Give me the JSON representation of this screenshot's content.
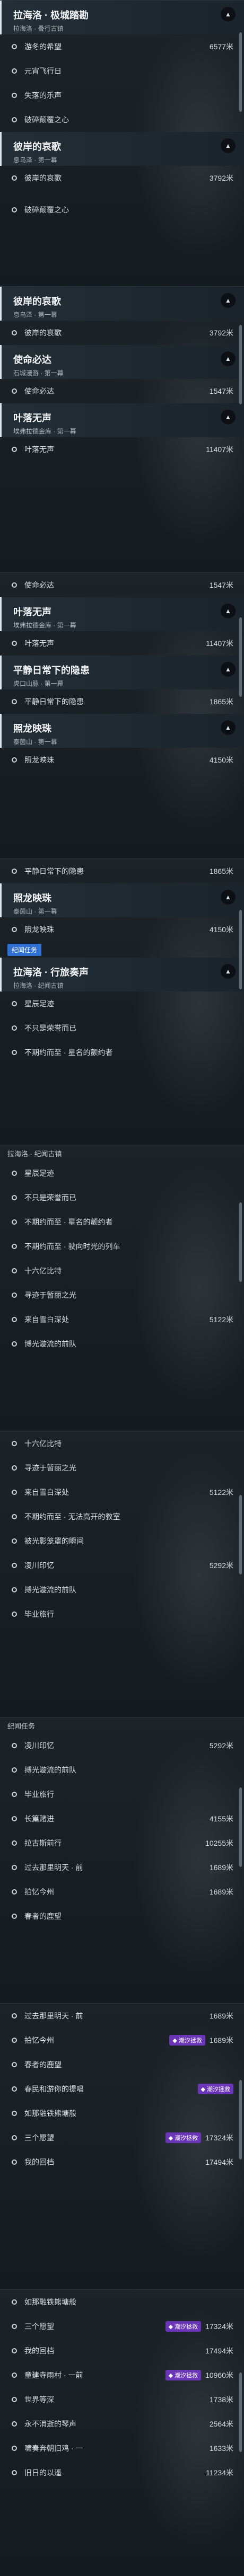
{
  "panels": [
    {
      "items": [
        {
          "type": "header",
          "title": "拉海洛 · 极城踏勘",
          "sub": "拉海洛 · 叠行古镇",
          "chevron": true
        },
        {
          "type": "item",
          "label": "游冬的希望",
          "dist": "6577米"
        },
        {
          "type": "item",
          "label": "元宵飞行日"
        },
        {
          "type": "item",
          "label": "失落的乐声"
        },
        {
          "type": "item",
          "label": "破碎颠覆之心"
        },
        {
          "type": "header",
          "title": "彼岸的哀歌",
          "sub": "息乌泽 · 第一幕",
          "chevron": true
        },
        {
          "type": "item",
          "label": "彼岸的哀歌",
          "dist": "3792米"
        },
        {
          "type": "spacer"
        },
        {
          "type": "item",
          "label": "破碎颠覆之心"
        }
      ]
    },
    {
      "items": [
        {
          "type": "header",
          "title": "彼岸的哀歌",
          "sub": "息乌泽 · 第一幕",
          "chevron": true
        },
        {
          "type": "item",
          "label": "彼岸的哀歌",
          "dist": "3792米"
        },
        {
          "type": "header",
          "title": "使命必达",
          "sub": "石城漫游 · 第一幕",
          "chevron": true
        },
        {
          "type": "item",
          "label": "使命必达",
          "dist": "1547米"
        },
        {
          "type": "header",
          "title": "叶落无声",
          "sub": "埃弗拉德金库 · 第一幕",
          "chevron": true
        },
        {
          "type": "item",
          "label": "叶落无声",
          "dist": "11407米"
        }
      ]
    },
    {
      "items": [
        {
          "type": "item",
          "label": "使命必达",
          "dist": "1547米"
        },
        {
          "type": "header",
          "title": "叶落无声",
          "sub": "埃弗拉德金库 · 第一幕",
          "chevron": true
        },
        {
          "type": "item",
          "label": "叶落无声",
          "dist": "11407米"
        },
        {
          "type": "header",
          "title": "平静日常下的隐患",
          "sub": "虎口山脉 · 第一幕",
          "chevron": true
        },
        {
          "type": "item",
          "label": "平静日常下的隐患",
          "dist": "1865米"
        },
        {
          "type": "header",
          "title": "照龙映珠",
          "sub": "泰茵山 · 第一幕",
          "chevron": true
        },
        {
          "type": "item",
          "label": "照龙映珠",
          "dist": "4150米"
        }
      ]
    },
    {
      "items": [
        {
          "type": "item",
          "label": "平静日常下的隐患",
          "dist": "1865米"
        },
        {
          "type": "header",
          "title": "照龙映珠",
          "sub": "泰茵山 · 第一幕",
          "chevron": true
        },
        {
          "type": "item",
          "label": "照龙映珠",
          "dist": "4150米"
        },
        {
          "type": "section-tag",
          "label": "纪闻任务"
        },
        {
          "type": "header",
          "title": "拉海洛 · 行旅奏声",
          "sub": "拉海洛 · 纪闻古镇",
          "chevron": true
        },
        {
          "type": "item",
          "label": "星辰足迹"
        },
        {
          "type": "item",
          "label": "不只是荣誉而已"
        },
        {
          "type": "item",
          "label": "不期约而至 · 星名的颤约者"
        }
      ]
    },
    {
      "items": [
        {
          "type": "section",
          "label": "拉海洛 · 纪闻古镇"
        },
        {
          "type": "item",
          "label": "星辰足迹"
        },
        {
          "type": "item",
          "label": "不只是荣誉而已"
        },
        {
          "type": "item",
          "label": "不期约而至 · 星名的颤约者"
        },
        {
          "type": "item",
          "label": "不期约而至 · 驶向时光的列车"
        },
        {
          "type": "item",
          "label": "十六亿比特"
        },
        {
          "type": "item",
          "label": "寻迹于暂丽之光"
        },
        {
          "type": "item",
          "label": "来自雪白深处",
          "dist": "5122米"
        },
        {
          "type": "item",
          "label": "博光漩流的前队"
        }
      ]
    },
    {
      "items": [
        {
          "type": "item",
          "label": "十六亿比特"
        },
        {
          "type": "item",
          "label": "寻迹于暂丽之光"
        },
        {
          "type": "item",
          "label": "来自雪白深处",
          "dist": "5122米"
        },
        {
          "type": "item",
          "label": "不期约而至 · 无法高开的教室"
        },
        {
          "type": "item",
          "label": "被光影笼罩的瞬间"
        },
        {
          "type": "item",
          "label": "凌川印忆",
          "dist": "5292米"
        },
        {
          "type": "item",
          "label": "搏光漩流的前队"
        },
        {
          "type": "item",
          "label": "毕业旅行"
        }
      ]
    },
    {
      "items": [
        {
          "type": "section",
          "label": "纪闻任务"
        },
        {
          "type": "item",
          "label": "凌川印忆",
          "dist": "5292米"
        },
        {
          "type": "item",
          "label": "搏光漩流的前队"
        },
        {
          "type": "item",
          "label": "毕业旅行"
        },
        {
          "type": "item",
          "label": "长篇赌进",
          "dist": "4155米"
        },
        {
          "type": "item",
          "label": "拉古斯前行",
          "dist": "10255米"
        },
        {
          "type": "item",
          "label": "过去那里明天 · 前",
          "dist": "1689米"
        },
        {
          "type": "item",
          "label": "拍忆今州",
          "dist": "1689米"
        },
        {
          "type": "item",
          "label": "春者的鹿望"
        }
      ]
    },
    {
      "items": [
        {
          "type": "item",
          "label": "过去那里明天 · 前",
          "dist": "1689米"
        },
        {
          "type": "item",
          "label": "拍忆今州",
          "dist": "1689米",
          "badge": "潮汐拯救"
        },
        {
          "type": "item",
          "label": "春者的鹿望"
        },
        {
          "type": "item",
          "label": "春民和游你的提唱",
          "badge": "潮汐拯救"
        },
        {
          "type": "item",
          "label": "如那融铁熊塘般"
        },
        {
          "type": "item",
          "label": "三个愿望",
          "dist": "17324米",
          "badge": "潮汐拯救"
        },
        {
          "type": "item",
          "label": "我的回档",
          "dist": "17494米"
        }
      ]
    },
    {
      "items": [
        {
          "type": "item",
          "label": "如那融铁熊塘般"
        },
        {
          "type": "item",
          "label": "三个愿望",
          "dist": "17324米",
          "badge": "潮汐拯救"
        },
        {
          "type": "item",
          "label": "我的回档",
          "dist": "17494米"
        },
        {
          "type": "item",
          "label": "童建寺雨村 · 一前",
          "dist": "10960米",
          "badge": "潮汐拯救"
        },
        {
          "type": "item",
          "label": "世界等深",
          "dist": "1738米"
        },
        {
          "type": "item",
          "label": "永不消逝的琴声",
          "dist": "2564米"
        },
        {
          "type": "item",
          "label": "啸奏奔朝旧鸡 · 一",
          "dist": "1633米"
        },
        {
          "type": "item",
          "label": "旧日的以遥",
          "dist": "11234米"
        }
      ]
    }
  ]
}
